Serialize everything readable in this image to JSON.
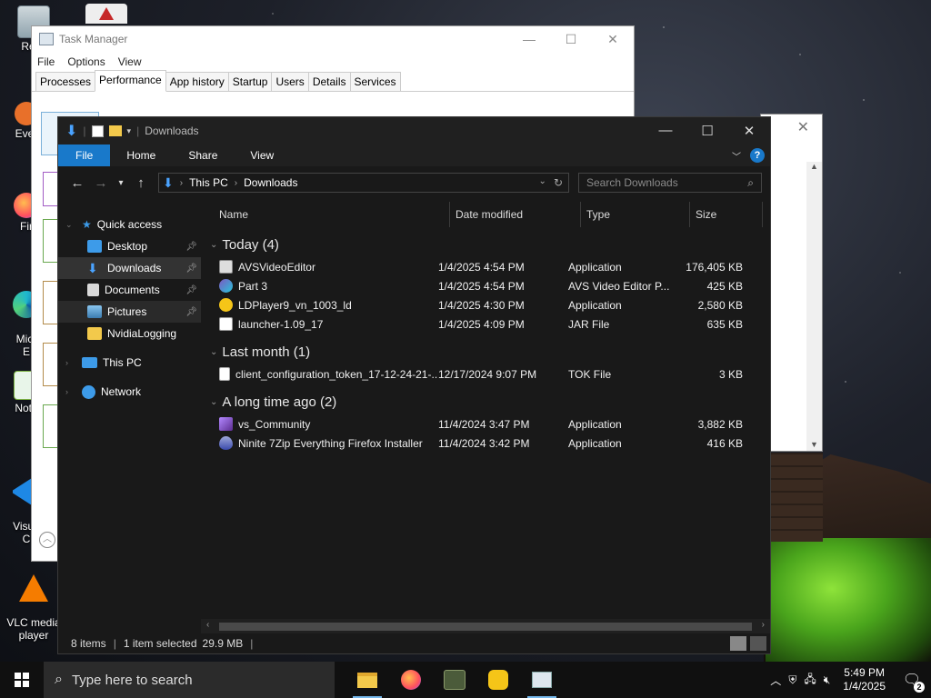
{
  "desktop": {
    "icons": [
      {
        "label": "Recy",
        "icon": "recycle-bin-icon"
      },
      {
        "label": "Ever",
        "icon": "everything-icon"
      },
      {
        "label": "Fir",
        "icon": "firefox-icon"
      },
      {
        "label": "Micr\nE",
        "icon": "edge-icon"
      },
      {
        "label": "Note",
        "icon": "notepad-plus-plus-icon"
      },
      {
        "label": "Visua\nC",
        "icon": "visual-studio-code-icon"
      },
      {
        "label": "VLC media\nplayer",
        "icon": "vlc-icon"
      }
    ]
  },
  "task_manager": {
    "title": "Task Manager",
    "menu": [
      "File",
      "Options",
      "View"
    ],
    "tabs": [
      "Processes",
      "Performance",
      "App history",
      "Startup",
      "Users",
      "Details",
      "Services"
    ],
    "active_tab": "Performance"
  },
  "explorer": {
    "title": "Downloads",
    "ribbon_tabs": [
      "File",
      "Home",
      "Share",
      "View"
    ],
    "address": {
      "root": "This PC",
      "current": "Downloads"
    },
    "search_placeholder": "Search Downloads",
    "nav": {
      "quick_access": "Quick access",
      "pinned": [
        {
          "label": "Desktop",
          "icon": "desktop-folder-icon",
          "pinned": true
        },
        {
          "label": "Downloads",
          "icon": "downloads-folder-icon",
          "pinned": true,
          "selected": true
        },
        {
          "label": "Documents",
          "icon": "documents-folder-icon",
          "pinned": true
        },
        {
          "label": "Pictures",
          "icon": "pictures-folder-icon",
          "pinned": true,
          "hover": true
        },
        {
          "label": "NvidiaLogging",
          "icon": "folder-icon",
          "pinned": false
        }
      ],
      "this_pc": "This PC",
      "network": "Network"
    },
    "columns": [
      "Name",
      "Date modified",
      "Type",
      "Size"
    ],
    "groups": [
      {
        "title": "Today (4)",
        "files": [
          {
            "name": "AVSVideoEditor",
            "date": "1/4/2025 4:54 PM",
            "type": "Application",
            "size": "176,405 KB",
            "icon": "avs-installer-icon"
          },
          {
            "name": "Part 3",
            "date": "1/4/2025 4:54 PM",
            "type": "AVS Video Editor P...",
            "size": "425 KB",
            "icon": "avs-project-icon"
          },
          {
            "name": "LDPlayer9_vn_1003_ld",
            "date": "1/4/2025 4:30 PM",
            "type": "Application",
            "size": "2,580 KB",
            "icon": "ldplayer-icon"
          },
          {
            "name": "launcher-1.09_17",
            "date": "1/4/2025 4:09 PM",
            "type": "JAR File",
            "size": "635 KB",
            "icon": "jar-file-icon"
          }
        ]
      },
      {
        "title": "Last month (1)",
        "files": [
          {
            "name": "client_configuration_token_17-12-24-21-...",
            "date": "12/17/2024 9:07 PM",
            "type": "TOK File",
            "size": "3 KB",
            "icon": "blank-file-icon"
          }
        ]
      },
      {
        "title": "A long time ago (2)",
        "files": [
          {
            "name": "vs_Community",
            "date": "11/4/2024 3:47 PM",
            "type": "Application",
            "size": "3,882 KB",
            "icon": "visual-studio-icon"
          },
          {
            "name": "Ninite 7Zip Everything Firefox Installer",
            "date": "11/4/2024 3:42 PM",
            "type": "Application",
            "size": "416 KB",
            "icon": "ninite-icon"
          }
        ]
      }
    ],
    "status": {
      "items": "8 items",
      "selected": "1 item selected",
      "size": "29.9 MB"
    }
  },
  "taskbar": {
    "search_placeholder": "Type here to search",
    "apps": [
      "file-explorer-icon",
      "firefox-icon",
      "game-launcher-icon",
      "ldplayer-icon",
      "task-manager-icon"
    ],
    "time": "5:49 PM",
    "date": "1/4/2025",
    "notifications": "2"
  },
  "colors": {
    "accent": "#1979ca",
    "explorer_bg": "#191919",
    "taskbar_bg": "#101010"
  }
}
